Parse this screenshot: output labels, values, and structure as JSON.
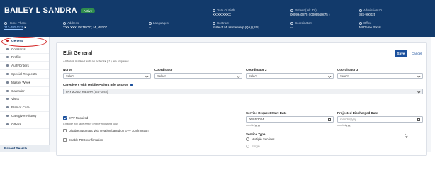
{
  "patient": {
    "name": "BAILEY L SANDRA",
    "status": "Active"
  },
  "header": {
    "home_phone": {
      "label": "Home Phone",
      "value": "213-480-1129"
    },
    "address": {
      "label": "Address",
      "value": "XXX XXX, DETROIT, MI, 48207"
    },
    "languages": {
      "label": "Languages",
      "value": "--"
    },
    "date_of_birth": {
      "label": "Date Of Birth",
      "value": "XX/XX/XXXX"
    },
    "contract": {
      "label": "Contract",
      "value": "State of MI Home Help (QA) (SIS)"
    },
    "patient_alt_id": {
      "label": "Patient ( Alt ID )",
      "value": "0009940875 ( 0009940875 )"
    },
    "coordinators": {
      "label": "Coordinators",
      "value": "--"
    },
    "admission_id": {
      "label": "Admission ID",
      "value": "SIS-900025"
    },
    "office": {
      "label": "Office",
      "value": "MI Demo Portal"
    }
  },
  "sidebar": {
    "items": [
      {
        "label": "General",
        "active": true
      },
      {
        "label": "Contracts"
      },
      {
        "label": "Profile"
      },
      {
        "label": "Auth/Orders"
      },
      {
        "label": "Special Requests"
      },
      {
        "label": "Master Week"
      },
      {
        "label": "Calendar"
      },
      {
        "label": "Visits"
      },
      {
        "label": "Plan of Care"
      },
      {
        "label": "Caregiver History"
      },
      {
        "label": "Others"
      }
    ],
    "patient_search": "Patient Search"
  },
  "form": {
    "title": "Edit General",
    "required_note": "All fields marked with an asterisk ( * ) are required.",
    "save_label": "Save",
    "cancel_label": "Cancel",
    "nurse": {
      "label": "Nurse",
      "value": "Select"
    },
    "coordinator": {
      "label": "Coordinator",
      "value": "Select"
    },
    "coordinator2": {
      "label": "Coordinator 2",
      "value": "Select"
    },
    "coordinator3": {
      "label": "Coordinator 3",
      "value": "Select"
    },
    "caregivers_access": {
      "label": "Caregivers with Mobile Patient Info Access",
      "value": "PAYMOND, KIESHA (SIS-1042)"
    },
    "evv_required": {
      "label": "EVV Required",
      "checked": true
    },
    "evv_note": "Change will take effect on the following day.",
    "disable_auto_creation": {
      "label": "Disable automatic visit creation based on EVV confirmation",
      "checked": false
    },
    "enable_pob": {
      "label": "Enable POB confirmation",
      "checked": false
    },
    "service_request_start": {
      "label": "Service Request Start Date",
      "value": "06/01/2024",
      "format": "mm/dd/yyyy"
    },
    "projected_discharged": {
      "label": "Projected Discharged Date",
      "value": "mm/dd/yyyy",
      "format": "mm/dd/yyyy"
    },
    "service_type": {
      "label": "Service Type",
      "option_multiple": "Multiple Services",
      "option_single": "Single"
    }
  },
  "colors": {
    "header_bg": "#123a6b",
    "accent": "#1a4f9c",
    "active_badge": "#2f8d4e",
    "highlight": "#d21f1f"
  }
}
